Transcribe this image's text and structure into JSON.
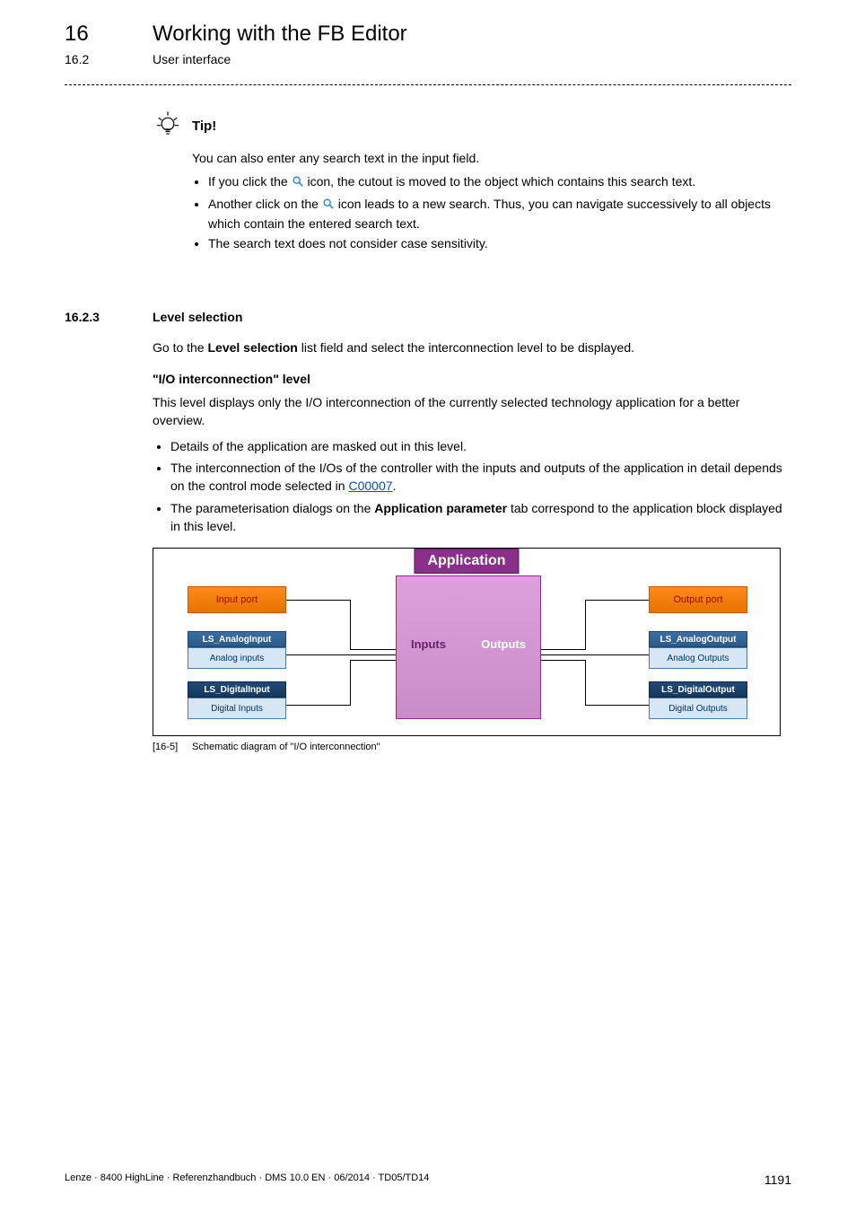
{
  "header": {
    "chapter_num": "16",
    "chapter_title": "Working with the FB Editor",
    "section_num": "16.2",
    "section_title": "User interface"
  },
  "tip": {
    "label": "Tip!",
    "intro": "You can also enter any search text in the input field.",
    "b1_pre": "If you click the ",
    "b1_post": " icon, the cutout is moved to the object which contains this search text.",
    "b2_pre": "Another click on the ",
    "b2_post": " icon leads to a new search. Thus, you can navigate successively to all objects which contain the entered search text.",
    "b3": "The search text does not consider case sensitivity."
  },
  "subsection": {
    "num": "16.2.3",
    "title": "Level selection",
    "intro_pre": "Go to the ",
    "intro_bold": "Level selection",
    "intro_post": " list field and select the interconnection level to be displayed.",
    "h_quoted": "\"I/O interconnection\" level",
    "p1": "This level displays only the I/O interconnection of the currently selected technology application for a better overview.",
    "li1": "Details of the application are masked out in this level.",
    "li2_pre": "The interconnection of the I/Os of the controller with the inputs and outputs of the application in detail depends on the control mode selected in ",
    "li2_link": "C00007",
    "li2_post": ".",
    "li3_pre": "The parameterisation dialogs on the ",
    "li3_bold": "Application parameter",
    "li3_post": " tab correspond to the application block displayed in this level."
  },
  "diagram": {
    "app": "Application",
    "inputs": "Inputs",
    "outputs": "Outputs",
    "input_port": "Input port",
    "output_port": "Output port",
    "ls_analog_in_h": "LS_AnalogInput",
    "ls_analog_in_b": "Analog inputs",
    "ls_digital_in_h": "LS_DigitalInput",
    "ls_digital_in_b": "Digital Inputs",
    "ls_analog_out_h": "LS_AnalogOutput",
    "ls_analog_out_b": "Analog Outputs",
    "ls_digital_out_h": "LS_DigitalOutput",
    "ls_digital_out_b": "Digital Outputs"
  },
  "caption": {
    "tag": "[16-5]",
    "text": "Schematic diagram of \"I/O interconnection\""
  },
  "footer": {
    "left": "Lenze · 8400 HighLine · Referenzhandbuch · DMS 10.0 EN · 06/2014 · TD05/TD14",
    "page": "1191"
  }
}
